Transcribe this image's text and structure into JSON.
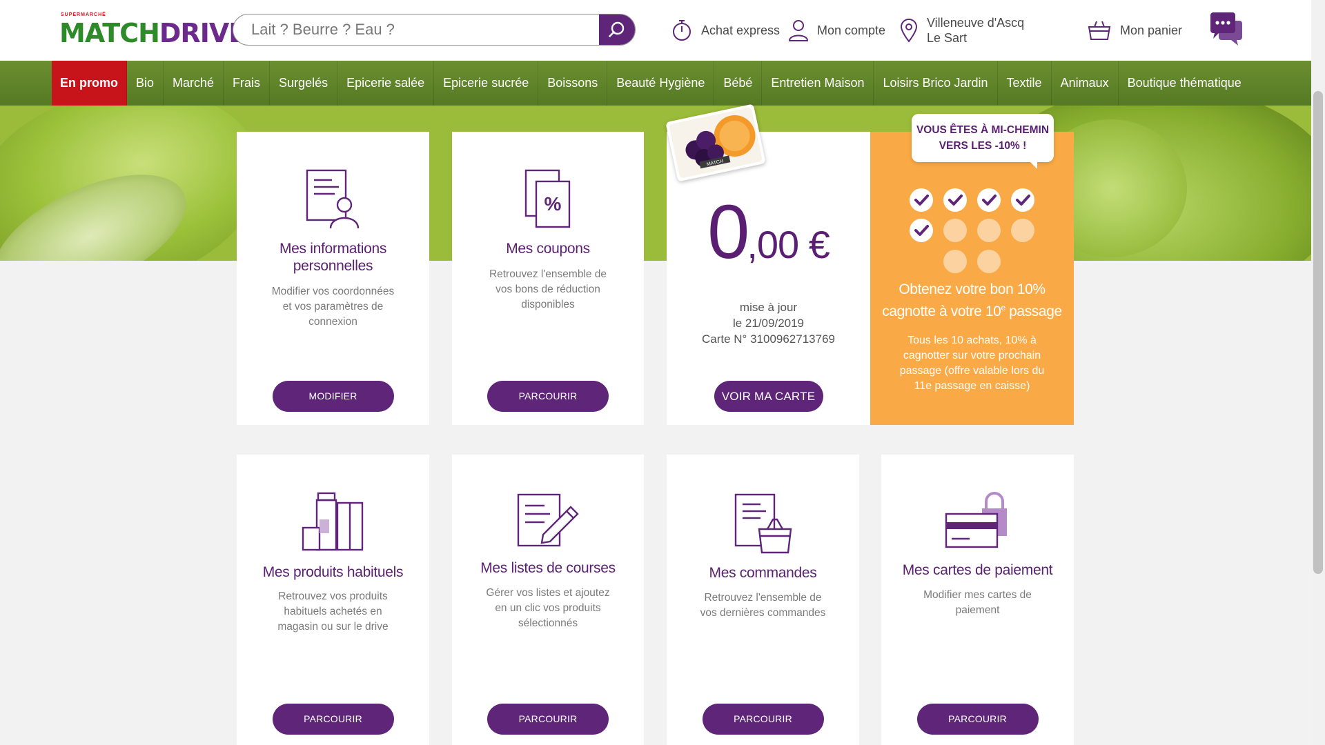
{
  "header": {
    "logo_super": "SUPERMARCHÉ",
    "logo_match": "MATCH",
    "logo_drive": "DRIVE",
    "search_placeholder": "Lait ? Beurre ? Eau ?",
    "express": "Achat express",
    "account": "Mon compte",
    "location": "Villeneuve d'Ascq Le Sart",
    "cart": "Mon panier"
  },
  "nav": {
    "items": [
      "En promo",
      "Bio",
      "Marché",
      "Frais",
      "Surgelés",
      "Epicerie salée",
      "Epicerie sucrée",
      "Boissons",
      "Beauté Hygiène",
      "Bébé",
      "Entretien Maison",
      "Loisirs Brico Jardin",
      "Textile",
      "Animaux",
      "Boutique thématique"
    ]
  },
  "cards": {
    "info": {
      "title": "Mes informations personnelles",
      "desc": "Modifier vos coordonnées et vos paramètres de connexion",
      "button": "MODIFIER"
    },
    "coupons": {
      "title": "Mes coupons",
      "desc": "Retrouvez l'ensemble de vos bons de réduction disponibles",
      "button": "PARCOURIR"
    },
    "loyalty": {
      "amount_main": "0",
      "amount_rest": ",00 €",
      "update_line1": "mise à jour",
      "update_line2": "le 21/09/2019",
      "card_number": "Carte N° 3100962713769",
      "button": "VOIR MA CARTE",
      "card_badge": "MATCH"
    },
    "progress": {
      "bubble": "VOUS ÊTES À MI-CHEMIN VERS LES -10% !",
      "title_pre": "Obtenez votre bon 10% cagnotte à votre 10",
      "title_sup": "e",
      "title_post": " passage",
      "desc": "Tous les 10 achats, 10% à cagnotter sur votre prochain passage (offre valable lors du 11e passage en caisse)",
      "checked": 5,
      "total": 10
    },
    "habits": {
      "title": "Mes produits habituels",
      "desc": "Retrouvez vos produits habituels achetés en magasin ou sur le drive",
      "button": "PARCOURIR"
    },
    "lists": {
      "title": "Mes listes de courses",
      "desc": "Gérer vos listes et ajoutez en un clic vos produits sélectionnés",
      "button": "PARCOURIR"
    },
    "orders": {
      "title": "Mes commandes",
      "desc": "Retrouvez l'ensemble de vos dernières commandes",
      "button": "PARCOURIR"
    },
    "payment": {
      "title": "Mes cartes de paiement",
      "desc": "Modifier mes cartes de paiement",
      "button": "PARCOURIR"
    }
  },
  "colors": {
    "purple": "#5f2578",
    "green": "#557a23",
    "red": "#c7141a",
    "orange": "#f9a945"
  }
}
